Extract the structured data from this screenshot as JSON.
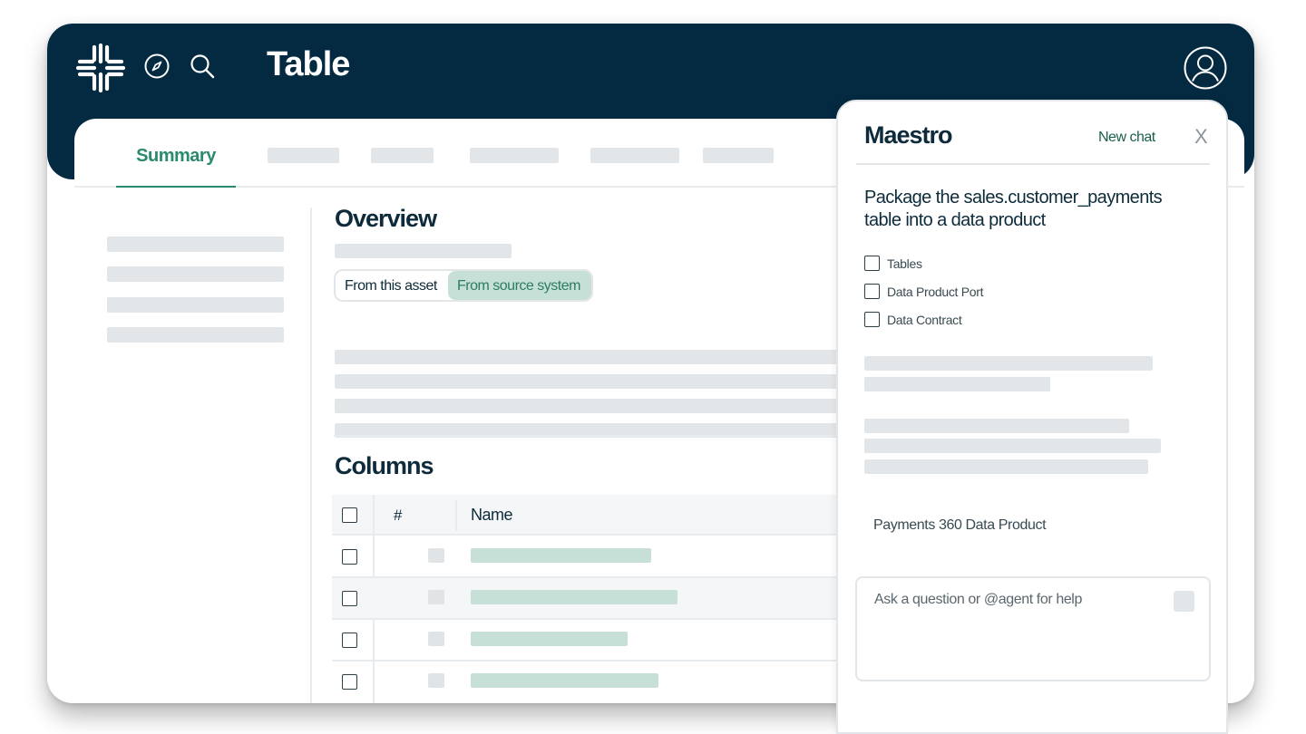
{
  "header": {
    "title": "Table",
    "logo_icon": "snowflake-icon",
    "nav_icons": [
      "compass-icon",
      "search-icon"
    ],
    "avatar_icon": "user-avatar-icon"
  },
  "tabs": {
    "active_label": "Summary",
    "placeholder_count": 5
  },
  "overview": {
    "heading": "Overview",
    "segment_options": [
      "From this asset",
      "From source system"
    ],
    "selected_segment": "From source system"
  },
  "columns": {
    "heading": "Columns",
    "headers": {
      "hash": "#",
      "name": "Name"
    },
    "row_count": 4
  },
  "maestro": {
    "title": "Maestro",
    "new_chat": "New chat",
    "close": "X",
    "prompt": "Package the sales.customer_payments table into a data product",
    "checklist": [
      {
        "label": "Tables",
        "checked": false
      },
      {
        "label": "Data Product Port",
        "checked": false
      },
      {
        "label": "Data Contract",
        "checked": false
      }
    ],
    "product_name": "Payments 360 Data Product",
    "input_placeholder": "Ask a question or @agent for help"
  },
  "colors": {
    "header_bg": "#032a40",
    "accent_green": "#2a8a6f",
    "selected_segment_bg": "#c7e0d7",
    "skeleton_gray": "#e3e6e8",
    "skeleton_green": "#c7e0d7"
  }
}
